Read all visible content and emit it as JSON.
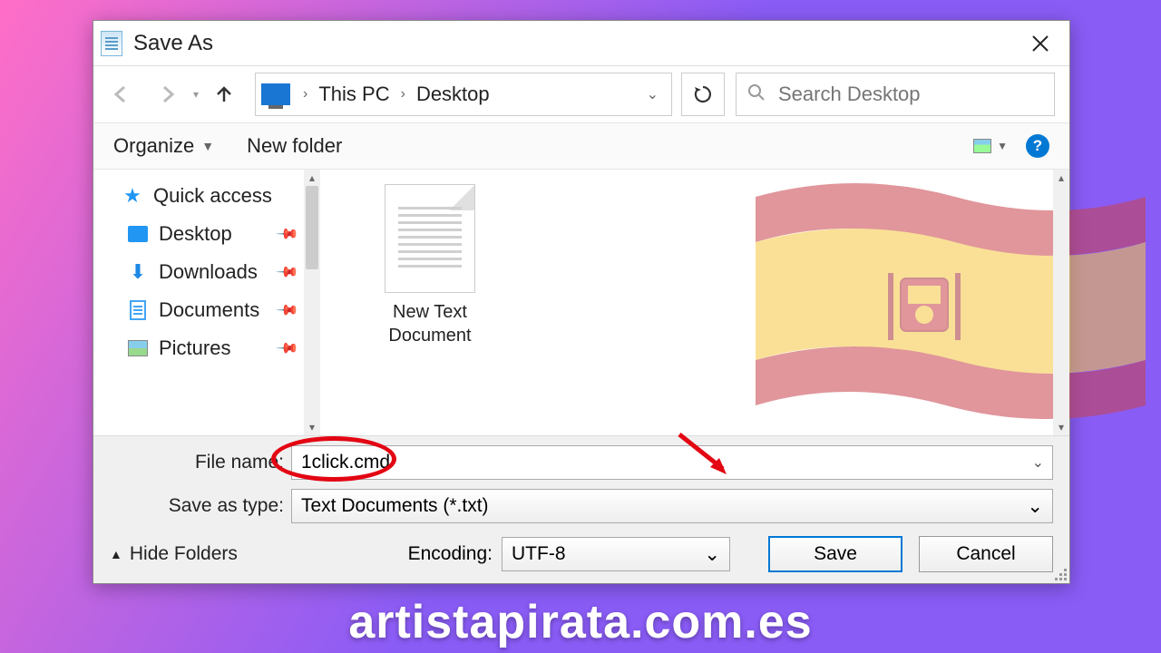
{
  "dialog": {
    "title": "Save As",
    "breadcrumb": {
      "root": "This PC",
      "folder": "Desktop"
    },
    "search_placeholder": "Search Desktop",
    "toolbar": {
      "organize": "Organize",
      "new_folder": "New folder"
    },
    "sidebar": {
      "quick_access": "Quick access",
      "items": [
        {
          "label": "Desktop"
        },
        {
          "label": "Downloads"
        },
        {
          "label": "Documents"
        },
        {
          "label": "Pictures"
        }
      ]
    },
    "files": [
      {
        "name": "New Text Document"
      }
    ],
    "file_name_label": "File name:",
    "file_name_value": "1click.cmd",
    "save_type_label": "Save as type:",
    "save_type_value": "Text Documents (*.txt)",
    "encoding_label": "Encoding:",
    "encoding_value": "UTF-8",
    "hide_folders": "Hide Folders",
    "save": "Save",
    "cancel": "Cancel"
  },
  "watermark": "artistapirata.com.es"
}
